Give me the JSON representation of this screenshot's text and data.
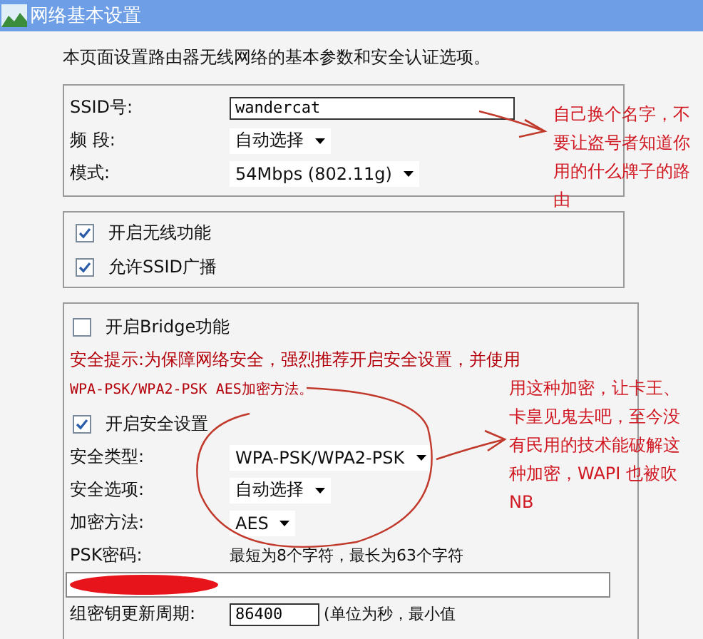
{
  "window": {
    "title": "网络基本设置"
  },
  "description": "本页面设置路由器无线网络的基本参数和安全认证选项。",
  "basic": {
    "fields": [
      {
        "kind": "text",
        "label": "SSID号:",
        "value": "wandercat"
      },
      {
        "kind": "select",
        "label": "频 段:",
        "value": "自动选择"
      },
      {
        "kind": "select",
        "label": "模式:",
        "value": "54Mbps (802.11g)"
      }
    ]
  },
  "switches": [
    {
      "label": "开启无线功能",
      "checked": true
    },
    {
      "label": "允许SSID广播",
      "checked": true
    }
  ],
  "security": {
    "bridge": {
      "label": "开启Bridge功能",
      "checked": false
    },
    "tip": "安全提示:为保障网络安全，强烈推荐开启安全设置，并使用",
    "tip_2": "WPA-PSK/WPA2-PSK AES加密方法。",
    "enable": {
      "label": "开启安全设置",
      "checked": true
    },
    "fields": [
      {
        "kind": "select",
        "label": "安全类型:",
        "value": "WPA-PSK/WPA2-PSK"
      },
      {
        "kind": "select",
        "label": "安全选项:",
        "value": "自动选择"
      },
      {
        "kind": "select",
        "label": "加密方法:",
        "value": "AES"
      }
    ],
    "psk_label": "PSK密码:",
    "psk_hint": "最短为8个字符，最长为63个字符",
    "group_key": {
      "label": "组密钥更新周期:",
      "value": "86400",
      "hint": "(单位为秒，最小值"
    }
  },
  "annotations": [
    {
      "text": "自己换个名字，不要让盗号者知道你用的什么牌子的路由"
    },
    {
      "text": "用这种加密，让卡王、卡皇见鬼去吧，至今没有民用的技术能破解这种加密，WAPI 也被吹 NB"
    }
  ]
}
